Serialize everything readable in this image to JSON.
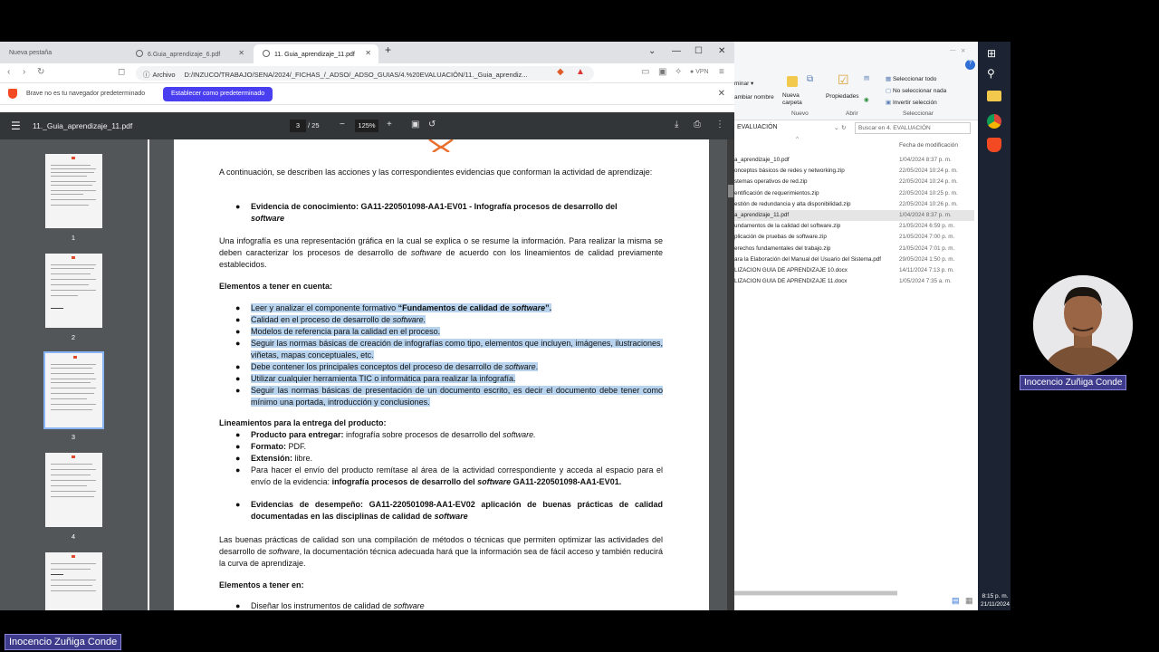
{
  "browser": {
    "tabs": [
      {
        "label": "Nueva pestaña"
      },
      {
        "label": "6.Guia_aprendizaje_6.pdf"
      },
      {
        "label": "11. Guia_aprendizaje_11.pdf"
      }
    ],
    "url_label": "Archivo",
    "url": "D:/INZUCO/TRABAJO/SENA/2024/_FICHAS_/_ADSO/_ADSO_GUIAS/4.%20EVALUACIÓN/11._Guia_aprendiz...",
    "vpn": "VPN",
    "info_message": "Brave no es tu navegador predeterminado",
    "set_default": "Establecer como predeterminado"
  },
  "pdf": {
    "filename": "11._Guia_aprendizaje_11.pdf",
    "current_page": "3",
    "total_pages": "/ 25",
    "zoom": "125%",
    "thumb_numbers": [
      "1",
      "2",
      "3",
      "4"
    ]
  },
  "doc": {
    "intro": "A continuación, se describen las acciones y las correspondientes evidencias que conforman la actividad de aprendizaje:",
    "evidence1_label": "Evidencia de conocimiento: GA11-220501098-AA1-EV01 - Infografía procesos de desarrollo del",
    "evidence1_italic": "software",
    "infografia_a": "Una infografía es una representación gráfica en la cual se explica o se resume la información. Para realizar la misma se deben caracterizar los procesos de desarrollo de ",
    "infografia_i": "software",
    "infografia_b": " de acuerdo con los lineamientos de calidad previamente establecidos.",
    "elements_heading": "Elementos a tener en cuenta:",
    "item1_a": "Leer y analizar el componente formativo ",
    "item1_b": "“Fundamentos de calidad de ",
    "item1_i": "software",
    "item1_c": "”.",
    "item2_a": "Calidad en el proceso de desarrollo de ",
    "item2_i": "software.",
    "item3": "Modelos de referencia para la calidad en el proceso.",
    "item4": "Seguir las normas básicas de creación de infografías como tipo, elementos que incluyen, imágenes, ilustraciones, viñetas, mapas conceptuales, etc.",
    "item5_a": "Debe contener los principales conceptos del proceso de desarrollo de ",
    "item5_i": "software",
    "item5_b": ".",
    "item6": "Utilizar cualquier herramienta TIC o informática para realizar la infografía.",
    "item7": "Seguir las normas básicas de presentación de un documento escrito, es decir el documento debe tener como mínimo una portada, introducción y conclusiones.",
    "guidelines_heading": "Lineamientos para la entrega del producto:",
    "g1_b": "Producto para entregar:",
    "g1_a": " infografía sobre procesos de desarrollo del ",
    "g1_i": "software.",
    "g2_b": "Formato:",
    "g2_a": " PDF.",
    "g3_b": "Extensión:",
    "g3_a": " libre.",
    "g4_a": "Para hacer el envío del producto remítase al área de la actividad correspondiente y acceda al espacio para el envío de la evidencia: ",
    "g4_b": "infografía procesos de desarrollo del ",
    "g4_i": "software",
    "g4_c": " GA11-220501098-AA1-EV01.",
    "evidence2_a": "Evidencias de desempeño: GA11-220501098-AA1-EV02 aplicación de buenas prácticas de calidad documentadas en las disciplinas de calidad de ",
    "evidence2_i": "software",
    "practices_a": "Las buenas prácticas de calidad son una compilación de métodos o técnicas que permiten optimizar las actividades del desarrollo de ",
    "practices_i": "software",
    "practices_b": ", la documentación técnica adecuada hará que la información sea de fácil acceso y también reducirá la curva de aprendizaje.",
    "elements2_heading": "Elementos a tener en:",
    "last_item_a": "Diseñar los instrumentos de calidad de ",
    "last_item_i": "software"
  },
  "explorer": {
    "ribbon": {
      "eliminar": "minar ▾",
      "cambiar_nombre": "ambiar nombre",
      "nueva_carpeta": "Nueva carpeta",
      "propiedades": "Propiedades",
      "sel_todo": "Seleccionar todo",
      "no_sel": "No seleccionar nada",
      "invertir": "Invertir selección",
      "group_nuevo": "Nuevo",
      "group_abrir": "Abrir",
      "group_sel": "Seleccionar"
    },
    "path": "EVALUACIÓN",
    "search_placeholder": "Buscar en 4. EVALUACIÓN",
    "col_date": "Fecha de modificación",
    "files": [
      {
        "name": "a_aprendizaje_10.pdf",
        "date": "1/04/2024 8:37 p. m."
      },
      {
        "name": "onceptos básicos de redes y networking.zip",
        "date": "22/05/2024 10:24 p. m."
      },
      {
        "name": "stemas operativos de red.zip",
        "date": "22/05/2024 10:24 p. m."
      },
      {
        "name": "entificación de requerimientos.zip",
        "date": "22/05/2024 10:25 p. m."
      },
      {
        "name": "estión de redundancia y alta disponibilidad.zip",
        "date": "22/05/2024 10:26 p. m."
      },
      {
        "name": "a_aprendizaje_11.pdf",
        "date": "1/04/2024 8:37 p. m."
      },
      {
        "name": "undamentos de la calidad del software.zip",
        "date": "21/05/2024 6:59 p. m."
      },
      {
        "name": "plicación de pruebas de software.zip",
        "date": "21/05/2024 7:00 p. m."
      },
      {
        "name": "erechos fundamentales del trabajo.zip",
        "date": "21/05/2024 7:01 p. m."
      },
      {
        "name": "ara la Elaboración del Manual del Usuario del Sistema.pdf",
        "date": "29/05/2024 1:50 p. m."
      },
      {
        "name": "LIZACIÓN GUÍA DE APRENDIZAJE 10.docx",
        "date": "14/11/2024 7:13 p. m."
      },
      {
        "name": "LIZACIÓN GUÍA DE APRENDIZAJE 11.docx",
        "date": "1/05/2024 7:35 a. m."
      }
    ]
  },
  "clock": {
    "time": "8:15 p. m.",
    "date": "21/11/2024"
  },
  "presenter": {
    "name": "Inocencio Zuñiga Conde"
  },
  "colors": {
    "accent": "#4a3ff0",
    "highlight": "#b7d3ee",
    "pdf_toolbar": "#323639",
    "viewer_bg": "#525659",
    "badge": "#3e3b8c"
  }
}
